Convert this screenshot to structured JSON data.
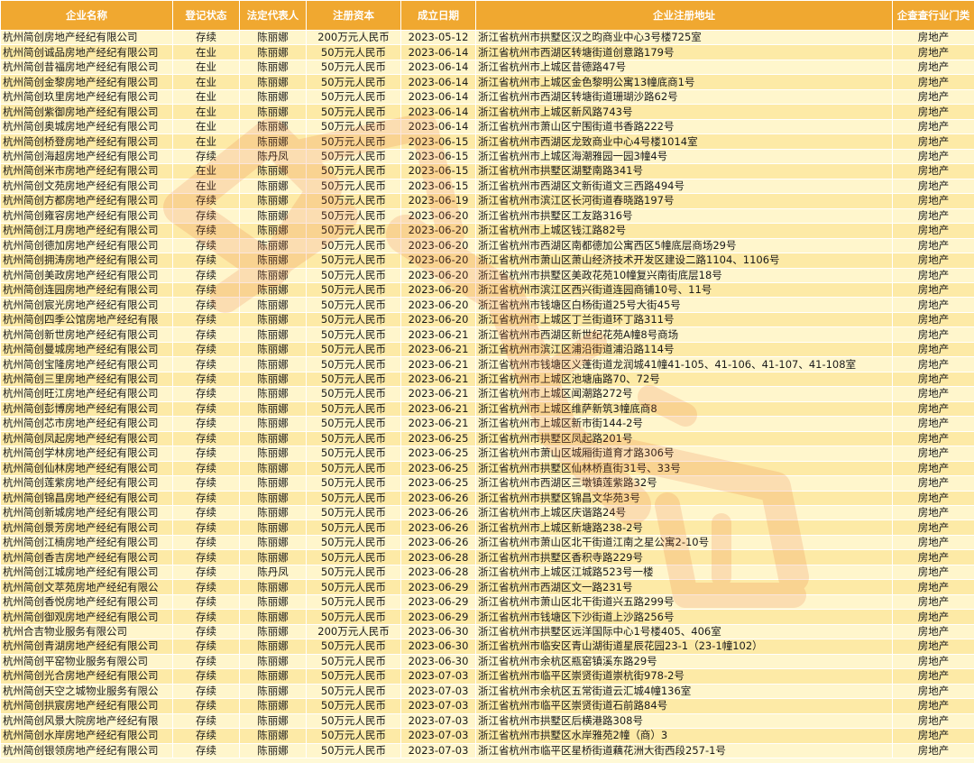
{
  "table": {
    "headers": [
      "企业名称",
      "登记状态",
      "法定代表人",
      "注册资本",
      "成立日期",
      "企业注册地址",
      "企查查行业门类"
    ],
    "rows": [
      [
        "杭州简创房地产经纪有限公司",
        "存续",
        "陈丽娜",
        "200万元人民币",
        "2023-05-12",
        "浙江省杭州市拱墅区汉之昀商业中心3号楼725室",
        "房地产"
      ],
      [
        "杭州简创诚品房地产经纪有限公司",
        "在业",
        "陈丽娜",
        "50万元人民币",
        "2023-06-14",
        "浙江省杭州市西湖区转塘街道创意路179号",
        "房地产"
      ],
      [
        "杭州简创昔福房地产经纪有限公司",
        "在业",
        "陈丽娜",
        "50万元人民币",
        "2023-06-14",
        "浙江省杭州市上城区昔德路47号",
        "房地产"
      ],
      [
        "杭州简创金黎房地产经纪有限公司",
        "在业",
        "陈丽娜",
        "50万元人民币",
        "2023-06-14",
        "浙江省杭州市上城区金色黎明公寓13幢底商1号",
        "房地产"
      ],
      [
        "杭州简创玖里房地产经纪有限公司",
        "在业",
        "陈丽娜",
        "50万元人民币",
        "2023-06-14",
        "浙江省杭州市西湖区转塘街道珊瑚沙路62号",
        "房地产"
      ],
      [
        "杭州简创紫御房地产经纪有限公司",
        "在业",
        "陈丽娜",
        "50万元人民币",
        "2023-06-14",
        "浙江省杭州市上城区新风路743号",
        "房地产"
      ],
      [
        "杭州简创奥城房地产经纪有限公司",
        "在业",
        "陈丽娜",
        "50万元人民币",
        "2023-06-14",
        "浙江省杭州市萧山区宁围街道书香路222号",
        "房地产"
      ],
      [
        "杭州简创桥登房地产经纪有限公司",
        "在业",
        "陈丽娜",
        "50万元人民币",
        "2023-06-15",
        "浙江省杭州市西湖区龙致商业中心4号楼1014室",
        "房地产"
      ],
      [
        "杭州简创海超房地产经纪有限公司",
        "存续",
        "陈丹凤",
        "50万元人民币",
        "2023-06-15",
        "浙江省杭州市上城区海潮雅园一园3幢4号",
        "房地产"
      ],
      [
        "杭州简创米市房地产经纪有限公司",
        "在业",
        "陈丽娜",
        "50万元人民币",
        "2023-06-15",
        "浙江省杭州市拱墅区湖墅南路341号",
        "房地产"
      ],
      [
        "杭州简创文苑房地产经纪有限公司",
        "在业",
        "陈丽娜",
        "50万元人民币",
        "2023-06-15",
        "浙江省杭州市西湖区文新街道文三西路494号",
        "房地产"
      ],
      [
        "杭州简创方都房地产经纪有限公司",
        "存续",
        "陈丽娜",
        "50万元人民币",
        "2023-06-19",
        "浙江省杭州市滨江区长河街道春晓路197号",
        "房地产"
      ],
      [
        "杭州简创雍容房地产经纪有限公司",
        "存续",
        "陈丽娜",
        "50万元人民币",
        "2023-06-20",
        "浙江省杭州市拱墅区工友路316号",
        "房地产"
      ],
      [
        "杭州简创江月房地产经纪有限公司",
        "存续",
        "陈丽娜",
        "50万元人民币",
        "2023-06-20",
        "浙江省杭州市上城区钱江路82号",
        "房地产"
      ],
      [
        "杭州简创德加房地产经纪有限公司",
        "存续",
        "陈丽娜",
        "50万元人民币",
        "2023-06-20",
        "浙江省杭州市西湖区南都德加公寓西区5幢底层商场29号",
        "房地产"
      ],
      [
        "杭州简创拥涛房地产经纪有限公司",
        "存续",
        "陈丽娜",
        "50万元人民币",
        "2023-06-20",
        "浙江省杭州市萧山区萧山经济技术开发区建设二路1104、1106号",
        "房地产"
      ],
      [
        "杭州简创美政房地产经纪有限公司",
        "存续",
        "陈丽娜",
        "50万元人民币",
        "2023-06-20",
        "浙江省杭州市拱墅区美政花苑10幢复兴南街底层18号",
        "房地产"
      ],
      [
        "杭州简创连园房地产经纪有限公司",
        "存续",
        "陈丽娜",
        "50万元人民币",
        "2023-06-20",
        "浙江省杭州市滨江区西兴街道连园商铺10号、11号",
        "房地产"
      ],
      [
        "杭州简创宸光房地产经纪有限公司",
        "存续",
        "陈丽娜",
        "50万元人民币",
        "2023-06-20",
        "浙江省杭州市钱塘区白杨街道25号大街45号",
        "房地产"
      ],
      [
        "杭州简创四季公馆房地产经纪有限",
        "存续",
        "陈丽娜",
        "50万元人民币",
        "2023-06-20",
        "浙江省杭州市上城区丁兰街道环丁路311号",
        "房地产"
      ],
      [
        "杭州简创新世房地产经纪有限公司",
        "存续",
        "陈丽娜",
        "50万元人民币",
        "2023-06-21",
        "浙江省杭州市西湖区新世纪花苑A幢8号商场",
        "房地产"
      ],
      [
        "杭州简创曼城房地产经纪有限公司",
        "存续",
        "陈丽娜",
        "50万元人民币",
        "2023-06-21",
        "浙江省杭州市滨江区浦沿街道浦沿路114号",
        "房地产"
      ],
      [
        "杭州简创宝隆房地产经纪有限公司",
        "存续",
        "陈丽娜",
        "50万元人民币",
        "2023-06-21",
        "浙江省杭州市钱塘区义蓬街道龙润城41幢41-105、41-106、41-107、41-108室",
        "房地产"
      ],
      [
        "杭州简创三里房地产经纪有限公司",
        "存续",
        "陈丽娜",
        "50万元人民币",
        "2023-06-21",
        "浙江省杭州市上城区池塘庙路70、72号",
        "房地产"
      ],
      [
        "杭州简创旺江房地产经纪有限公司",
        "存续",
        "陈丽娜",
        "50万元人民币",
        "2023-06-21",
        "浙江省杭州市上城区闻潮路272号",
        "房地产"
      ],
      [
        "杭州简创彭博房地产经纪有限公司",
        "存续",
        "陈丽娜",
        "50万元人民币",
        "2023-06-21",
        "浙江省杭州市上城区维萨新筑3幢底商8",
        "房地产"
      ],
      [
        "杭州简创芯市房地产经纪有限公司",
        "存续",
        "陈丽娜",
        "50万元人民币",
        "2023-06-21",
        "浙江省杭州市上城区新市街144-2号",
        "房地产"
      ],
      [
        "杭州简创凤起房地产经纪有限公司",
        "存续",
        "陈丽娜",
        "50万元人民币",
        "2023-06-25",
        "浙江省杭州市拱墅区凤起路201号",
        "房地产"
      ],
      [
        "杭州简创学林房地产经纪有限公司",
        "存续",
        "陈丽娜",
        "50万元人民币",
        "2023-06-25",
        "浙江省杭州市萧山区城厢街道育才路306号",
        "房地产"
      ],
      [
        "杭州简创仙林房地产经纪有限公司",
        "存续",
        "陈丽娜",
        "50万元人民币",
        "2023-06-25",
        "浙江省杭州市拱墅区仙林桥直街31号、33号",
        "房地产"
      ],
      [
        "杭州简创莲紫房地产经纪有限公司",
        "存续",
        "陈丽娜",
        "50万元人民币",
        "2023-06-25",
        "浙江省杭州市西湖区三墩镇莲紫路32号",
        "房地产"
      ],
      [
        "杭州简创锦昌房地产经纪有限公司",
        "存续",
        "陈丽娜",
        "50万元人民币",
        "2023-06-26",
        "浙江省杭州市拱墅区锦昌文华苑3号",
        "房地产"
      ],
      [
        "杭州简创新城房地产经纪有限公司",
        "存续",
        "陈丽娜",
        "50万元人民币",
        "2023-06-26",
        "浙江省杭州市上城区庆谐路24号",
        "房地产"
      ],
      [
        "杭州简创景芳房地产经纪有限公司",
        "存续",
        "陈丽娜",
        "50万元人民币",
        "2023-06-26",
        "浙江省杭州市上城区新塘路238-2号",
        "房地产"
      ],
      [
        "杭州简创江楠房地产经纪有限公司",
        "存续",
        "陈丽娜",
        "50万元人民币",
        "2023-06-26",
        "浙江省杭州市萧山区北干街道江南之星公寓2-10号",
        "房地产"
      ],
      [
        "杭州简创香吉房地产经纪有限公司",
        "存续",
        "陈丽娜",
        "50万元人民币",
        "2023-06-28",
        "浙江省杭州市拱墅区香积寺路229号",
        "房地产"
      ],
      [
        "杭州简创江城房地产经纪有限公司",
        "存续",
        "陈丹凤",
        "50万元人民币",
        "2023-06-28",
        "浙江省杭州市上城区江城路523号一楼",
        "房地产"
      ],
      [
        "杭州简创文萃苑房地产经纪有限公",
        "存续",
        "陈丽娜",
        "50万元人民币",
        "2023-06-29",
        "浙江省杭州市西湖区文一路231号",
        "房地产"
      ],
      [
        "杭州简创香悦房地产经纪有限公司",
        "存续",
        "陈丽娜",
        "50万元人民币",
        "2023-06-29",
        "浙江省杭州市萧山区北干街道兴五路299号",
        "房地产"
      ],
      [
        "杭州简创御观房地产经纪有限公司",
        "存续",
        "陈丽娜",
        "50万元人民币",
        "2023-06-29",
        "浙江省杭州市钱塘区下沙街道上沙路256号",
        "房地产"
      ],
      [
        "杭州合吉物业服务有限公司",
        "存续",
        "陈丽娜",
        "200万元人民币",
        "2023-06-30",
        "浙江省杭州市拱墅区远洋国际中心1号楼405、406室",
        "房地产"
      ],
      [
        "杭州简创青湖房地产经纪有限公司",
        "存续",
        "陈丽娜",
        "50万元人民币",
        "2023-06-30",
        "浙江省杭州市临安区青山湖街道星辰花园23-1（23-1幢102）",
        "房地产"
      ],
      [
        "杭州简创平窑物业服务有限公司",
        "存续",
        "陈丽娜",
        "50万元人民币",
        "2023-06-30",
        "浙江省杭州市余杭区瓶窑镇溪东路29号",
        "房地产"
      ],
      [
        "杭州简创光合房地产经纪有限公司",
        "存续",
        "陈丽娜",
        "50万元人民币",
        "2023-07-03",
        "浙江省杭州市临平区崇贤街道崇杭街978-2号",
        "房地产"
      ],
      [
        "杭州简创天空之城物业服务有限公",
        "存续",
        "陈丽娜",
        "50万元人民币",
        "2023-07-03",
        "浙江省杭州市余杭区五常街道云汇城4幢136室",
        "房地产"
      ],
      [
        "杭州简创拱宸房地产经纪有限公司",
        "存续",
        "陈丽娜",
        "50万元人民币",
        "2023-07-03",
        "浙江省杭州市临平区崇贤街道石前路84号",
        "房地产"
      ],
      [
        "杭州简创风景大院房地产经纪有限",
        "存续",
        "陈丽娜",
        "50万元人民币",
        "2023-07-03",
        "浙江省杭州市拱墅区后横港路308号",
        "房地产"
      ],
      [
        "杭州简创水岸房地产经纪有限公司",
        "存续",
        "陈丽娜",
        "50万元人民币",
        "2023-07-03",
        "浙江省杭州市拱墅区水岸雅苑2幢（商）3",
        "房地产"
      ],
      [
        "杭州简创银领房地产经纪有限公司",
        "存续",
        "陈丽娜",
        "50万元人民币",
        "2023-07-03",
        "浙江省杭州市临平区星桥街道藕花洲大街西段257-1号",
        "房地产"
      ]
    ]
  },
  "colors": {
    "header_bg": "#f0a830",
    "row_odd": "#fff6cc",
    "row_even": "#fdeaa6",
    "watermark": "#e8622a"
  }
}
